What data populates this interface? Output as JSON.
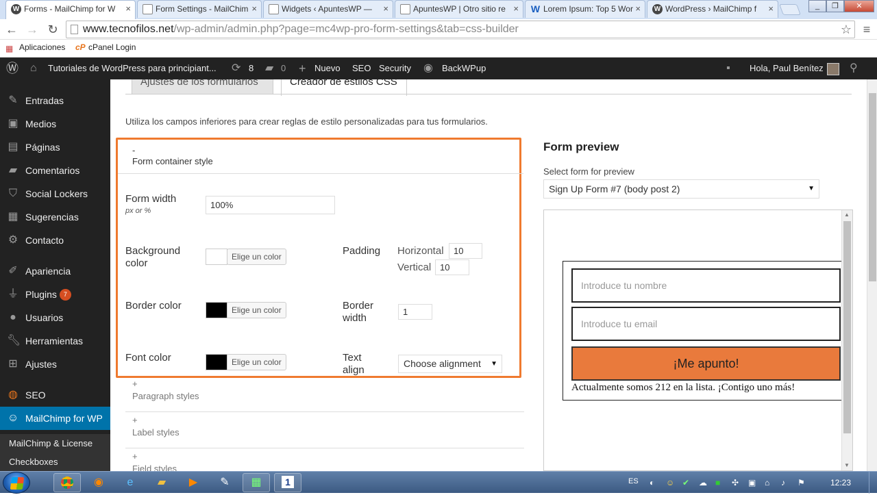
{
  "browser": {
    "tabs": [
      {
        "title": "Forms - MailChimp for W",
        "icon": "wordpress-icon",
        "active": true
      },
      {
        "title": "Form Settings - MailChim",
        "icon": "page-icon",
        "active": false
      },
      {
        "title": "Widgets ‹ ApuntesWP —",
        "icon": "page-icon",
        "active": false
      },
      {
        "title": "ApuntesWP | Otro sitio re",
        "icon": "page-icon",
        "active": false
      },
      {
        "title": "Lorem Ipsum: Top 5 Wor",
        "icon": "lorem-icon",
        "active": false
      },
      {
        "title": "WordPress › MailChimp f",
        "icon": "wordpress-icon",
        "active": false
      }
    ],
    "url_host": "www.tecnofilos.net",
    "url_path": "/wp-admin/admin.php?page=mc4wp-pro-form-settings&tab=css-builder",
    "bookmarks": [
      {
        "label": "Aplicaciones",
        "icon": "apps-grid-icon"
      },
      {
        "label": "cPanel Login",
        "icon": "cpanel-icon"
      }
    ]
  },
  "adminbar": {
    "site_name": "Tutoriales de WordPress para principiant...",
    "updates": "8",
    "comments": "0",
    "new_label": "Nuevo",
    "seo": "SEO",
    "security": "Security",
    "backwpup": "BackWPup",
    "greeting": "Hola, Paul Benítez"
  },
  "sidebar": {
    "items": [
      {
        "label": "Entradas",
        "icon": "pin-icon"
      },
      {
        "label": "Medios",
        "icon": "media-icon"
      },
      {
        "label": "Páginas",
        "icon": "pages-icon"
      },
      {
        "label": "Comentarios",
        "icon": "comment-icon"
      },
      {
        "label": "Social Lockers",
        "icon": "lock-icon"
      },
      {
        "label": "Sugerencias",
        "icon": "suggestions-icon"
      },
      {
        "label": "Contacto",
        "icon": "gear-icon"
      },
      {
        "label": "Apariencia",
        "icon": "brush-icon"
      },
      {
        "label": "Plugins",
        "icon": "plugin-icon",
        "badge": "7"
      },
      {
        "label": "Usuarios",
        "icon": "user-icon"
      },
      {
        "label": "Herramientas",
        "icon": "wrench-icon"
      },
      {
        "label": "Ajustes",
        "icon": "settings-icon"
      },
      {
        "label": "SEO",
        "icon": "seo-icon"
      },
      {
        "label": "MailChimp for WP",
        "icon": "mailchimp-icon",
        "active": true
      }
    ],
    "submenu": [
      "MailChimp & License",
      "Checkboxes"
    ]
  },
  "page": {
    "tabs": [
      "Ajustes de los formularios",
      "Creador de estilos CSS"
    ],
    "active_tab": 1,
    "intro": "Utiliza los campos inferiores para crear reglas de estilo personalizadas para tus formularios.",
    "container_section": {
      "toggle": "-",
      "title": "Form container style",
      "form_width_label": "Form width",
      "form_width_hint": "px or %",
      "form_width_value": "100%",
      "background_color_label": "Background color",
      "border_color_label": "Border color",
      "font_color_label": "Font color",
      "pick_color_label": "Elige un color",
      "background_color": "#ffffff",
      "border_color": "#000000",
      "font_color": "#000000",
      "padding_label": "Padding",
      "horizontal_label": "Horizontal",
      "horizontal_value": "10",
      "vertical_label": "Vertical",
      "vertical_value": "10",
      "border_width_label": "Border width",
      "border_width_value": "1",
      "text_align_label": "Text align",
      "text_align_value": "Choose alignment"
    },
    "collapsed_sections": [
      {
        "toggle": "+",
        "title": "Paragraph styles"
      },
      {
        "toggle": "+",
        "title": "Label styles"
      },
      {
        "toggle": "+",
        "title": "Field styles"
      }
    ],
    "highlight_color": "#ef7a2f"
  },
  "preview": {
    "heading": "Form preview",
    "select_label": "Select form for preview",
    "select_value": "Sign Up Form #7 (body post 2)",
    "name_placeholder": "Introduce tu nombre",
    "email_placeholder": "Introduce tu email",
    "submit_label": "¡Me apunto!",
    "submit_color": "#e97a3c",
    "message": "Actualmente somos 212 en la lista. ¡Contigo uno más!"
  },
  "taskbar": {
    "language": "ES",
    "time": "12:23",
    "task_badge": "1"
  }
}
